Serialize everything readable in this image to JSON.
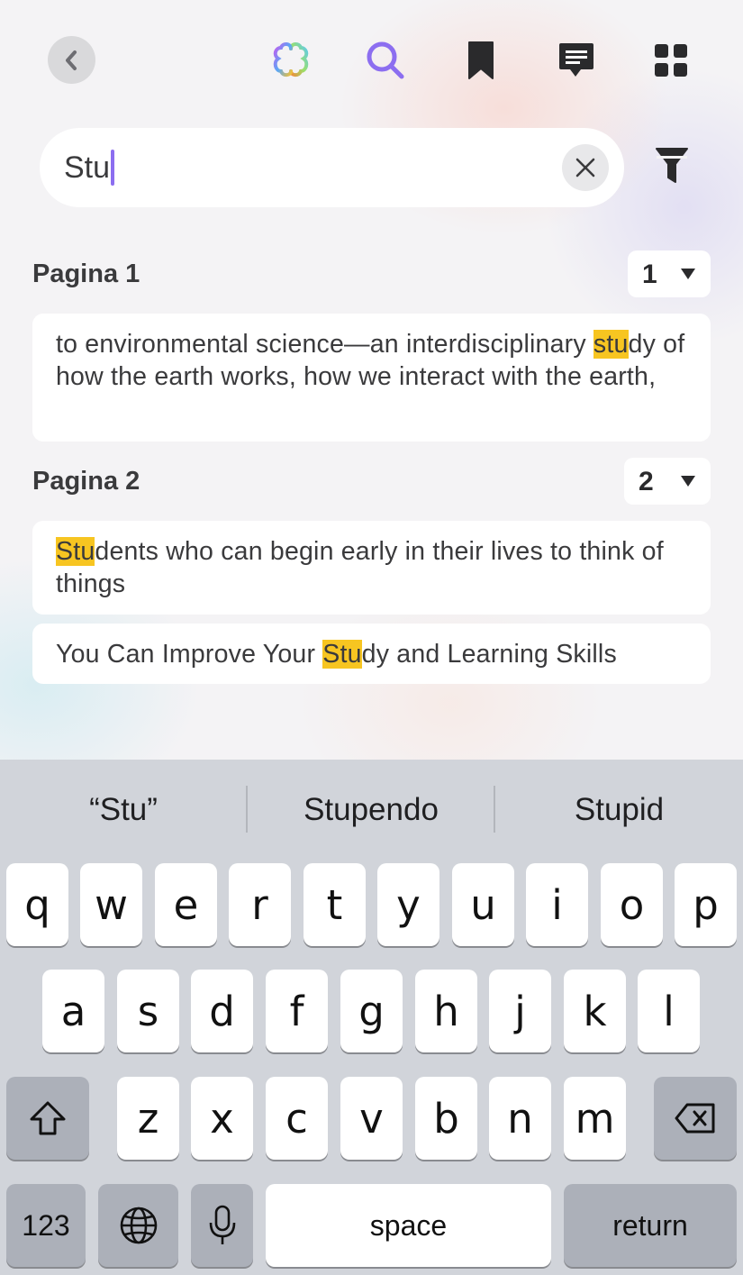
{
  "toolbar": {
    "icons": [
      "chevron-left-icon",
      "app-logo-icon",
      "search-icon",
      "bookmark-icon",
      "comment-icon",
      "grid-icon"
    ],
    "search_accent": "#8c6ef0"
  },
  "search": {
    "value": "Stu"
  },
  "results": {
    "highlight_color": "#f7c521",
    "groups": [
      {
        "title": "Pagina 1",
        "page_number": "1",
        "items": [
          {
            "before": "to environmental science—an interdisciplinary ",
            "match": "stu",
            "after": "dy of how the earth works, how we interact with the earth,"
          }
        ]
      },
      {
        "title": "Pagina 2",
        "page_number": "2",
        "items": [
          {
            "before": "",
            "match": "Stu",
            "after": "dents who can begin early in their lives to think of things"
          },
          {
            "before": "You Can Improve Your ",
            "match": "Stu",
            "after": "dy and Learning Skills"
          }
        ]
      }
    ]
  },
  "keyboard": {
    "suggestions": [
      "“Stu”",
      "Stupendo",
      "Stupid"
    ],
    "row1": [
      "q",
      "w",
      "e",
      "r",
      "t",
      "y",
      "u",
      "i",
      "o",
      "p"
    ],
    "row2": [
      "a",
      "s",
      "d",
      "f",
      "g",
      "h",
      "j",
      "k",
      "l"
    ],
    "row3": [
      "z",
      "x",
      "c",
      "v",
      "b",
      "n",
      "m"
    ],
    "numbers_label": "123",
    "space_label": "space",
    "return_label": "return"
  }
}
